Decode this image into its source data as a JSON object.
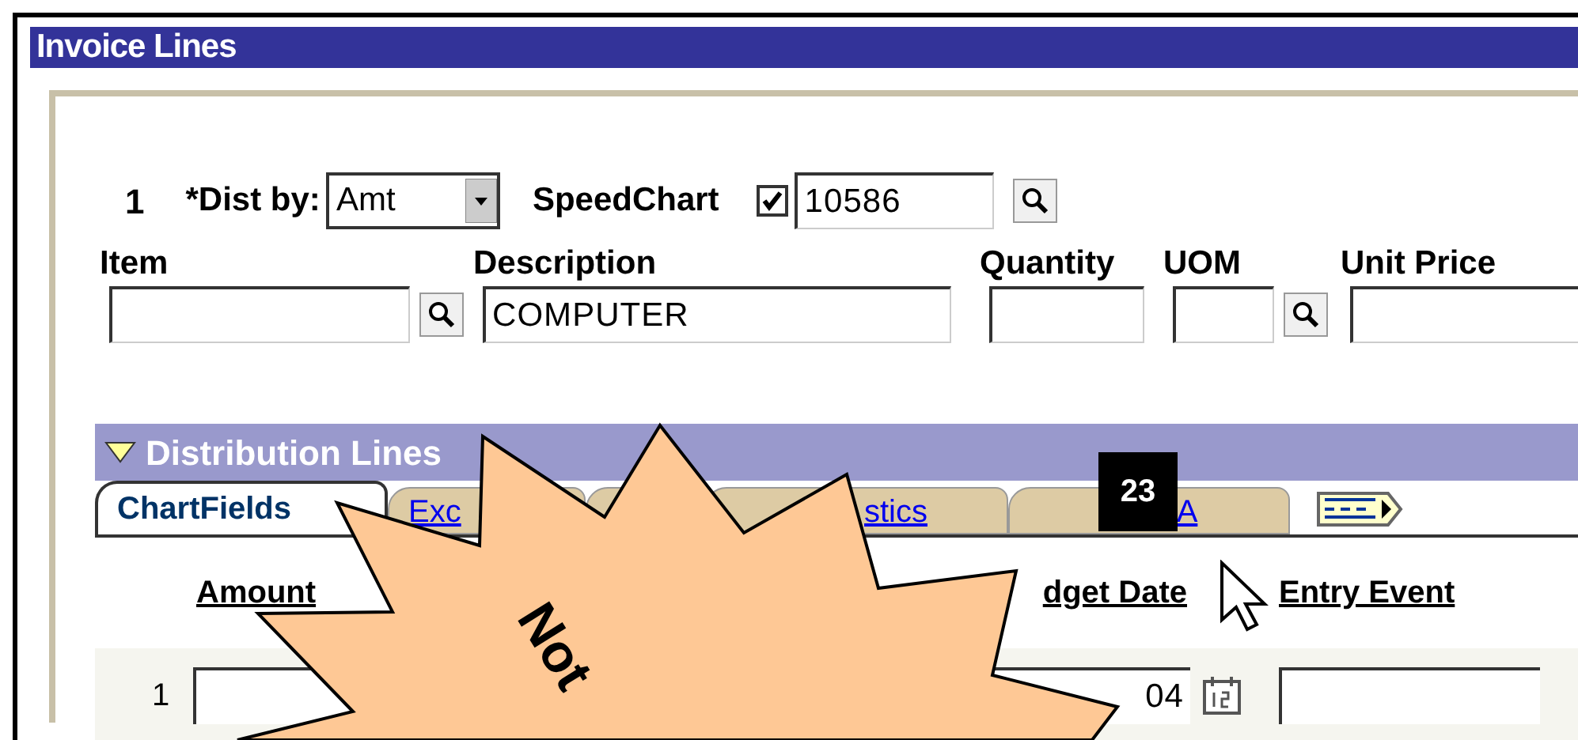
{
  "window": {
    "title": "Invoice Lines"
  },
  "line": {
    "number": "1",
    "dist_by_label": "*Dist by:",
    "dist_by_value": "Amt",
    "speedchart_label": "SpeedChart",
    "speedchart_checked": true,
    "speedchart_value": "10586"
  },
  "fields": [
    {
      "label": "Item",
      "lookup": true
    },
    {
      "label": "Description",
      "value": "COMPUTER",
      "lookup": false
    },
    {
      "label": "Quantity",
      "lookup": false
    },
    {
      "label": "UOM",
      "lookup": true
    },
    {
      "label": "Unit Price",
      "lookup": false
    }
  ],
  "distribution": {
    "title": "Distribution Lines",
    "expanded": true,
    "tabs": [
      {
        "label": "ChartFields",
        "selected": true
      },
      {
        "label": "Exc",
        "selected": false
      },
      {
        "selected": false
      },
      {
        "label": "stics",
        "selected": false
      },
      {
        "label": "A",
        "selected": false
      }
    ],
    "columns": [
      "Amount",
      "dget Date",
      "Entry Event"
    ],
    "rows": [
      {
        "number": "1",
        "budget_date": "04"
      }
    ]
  },
  "callout": {
    "text": "Not",
    "step": "23"
  }
}
